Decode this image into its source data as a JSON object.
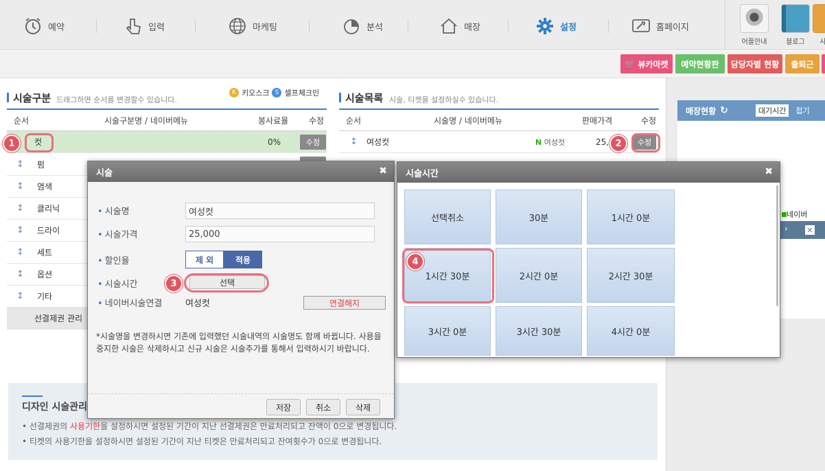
{
  "nav": {
    "items": [
      {
        "label": "예약",
        "icon": "alarm-clock-icon"
      },
      {
        "label": "입력",
        "icon": "touch-hand-icon"
      },
      {
        "label": "마케팅",
        "icon": "globe-icon"
      },
      {
        "label": "분석",
        "icon": "pie-chart-icon"
      },
      {
        "label": "매장",
        "icon": "house-icon"
      },
      {
        "label": "설정",
        "icon": "gear-icon",
        "active": true
      },
      {
        "label": "홈페이지",
        "icon": "wrench-screen-icon"
      }
    ],
    "quick": [
      {
        "label": "어플안내"
      },
      {
        "label": "블로그"
      },
      {
        "label": "사"
      }
    ]
  },
  "subbar": {
    "buttons": [
      {
        "label": "뷰카마켓",
        "color": "#e8557a"
      },
      {
        "label": "예약현황판",
        "color": "#6bbf6b"
      },
      {
        "label": "담당자별 현황",
        "color": "#e05d5d"
      },
      {
        "label": "출퇴근",
        "color": "#e6a23c"
      }
    ]
  },
  "left": {
    "title": "시술구분",
    "desc": "드래그하면 순서를 변경할수 있습니다.",
    "kiosk": "키오스크",
    "selfcheck": "셀프체크인",
    "headers": {
      "order": "순서",
      "name": "시술구분명 / 네이버메뉴",
      "rate": "봉사료율",
      "edit": "수정"
    },
    "rows": [
      {
        "name": "컷",
        "rate": "0%",
        "edit": "수정"
      },
      {
        "name": "펌"
      },
      {
        "name": "염색"
      },
      {
        "name": "클리닉"
      },
      {
        "name": "드라이"
      },
      {
        "name": "세트"
      },
      {
        "name": "옵션"
      },
      {
        "name": "기타"
      }
    ],
    "footer": "선결제권 관리"
  },
  "middle": {
    "title": "시술목록",
    "desc": "시술, 티켓을 설정하실수 있습니다.",
    "headers": {
      "order": "순서",
      "name": "시술명 / 네이버메뉴",
      "price": "판매가격",
      "edit": "수정"
    },
    "row": {
      "name": "여성컷",
      "naver": "여성컷",
      "price": "25,0",
      "edit": "수정"
    }
  },
  "right": {
    "title": "매장현황",
    "wait": "대기시간",
    "fold": "접기",
    "naver": "네이버"
  },
  "info": {
    "title": "디자인 시술관리",
    "line1_pre": "선결제권의 ",
    "line1_red": "사용기한",
    "line1_post": "을 설정하시면 설정된 기간이 지난 선결제권은 만료처리되고 잔액이 0으로 변경됩니다.",
    "line2": "티켓의 사용기한을 설정하시면 설정된 기간이 지난 티켓은 만료처리되고 잔여횟수가 0으로 변경됩니다."
  },
  "dialog1": {
    "title": "시술",
    "name_label": "시술명",
    "name_value": "여성컷",
    "price_label": "시술가격",
    "price_value": "25,000",
    "discount_label": "할인율",
    "discount_off": "제 외",
    "discount_on": "적용",
    "time_label": "시술시간",
    "time_button": "선택",
    "naver_label": "네이버시술연결",
    "naver_value": "여성컷",
    "unlink": "연결해지",
    "notice": "*시술명을 변경하시면 기존에 입력했던 시술내역의 시술명도 함께 바뀝니다. 사용을 중지한 시술은 삭제하시고 신규 시술은 시술추가를 통해서 입력하시기 바랍니다.",
    "save": "저장",
    "cancel": "취소",
    "delete": "삭제"
  },
  "dialog2": {
    "title": "시술시간",
    "cells": [
      "선택취소",
      "30분",
      "1시간 0분",
      "1시간 30분",
      "2시간 0분",
      "2시간 30분",
      "3시간 0분",
      "3시간 30분",
      "4시간 0분"
    ]
  },
  "steps": [
    "1",
    "2",
    "3",
    "4"
  ]
}
